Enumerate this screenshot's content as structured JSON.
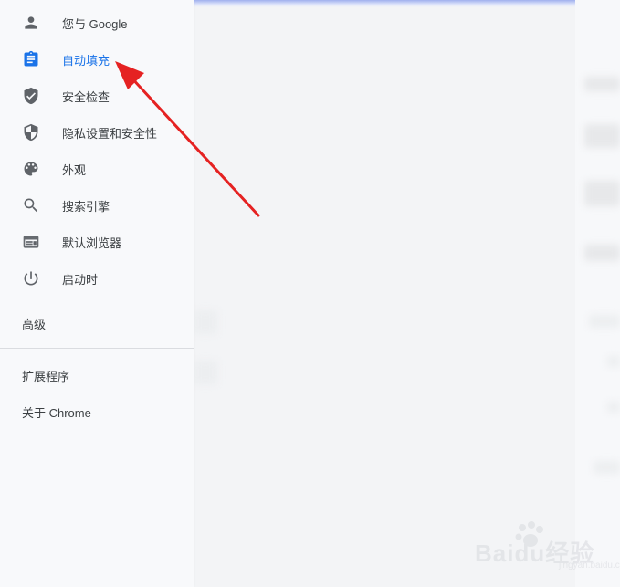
{
  "sidebar": {
    "items": [
      {
        "label": "您与 Google",
        "icon": "person-icon"
      },
      {
        "label": "自动填充",
        "icon": "clipboard-icon",
        "active": true
      },
      {
        "label": "安全检查",
        "icon": "shield-check-icon"
      },
      {
        "label": "隐私设置和安全性",
        "icon": "shield-half-icon"
      },
      {
        "label": "外观",
        "icon": "palette-icon"
      },
      {
        "label": "搜索引擎",
        "icon": "search-icon"
      },
      {
        "label": "默认浏览器",
        "icon": "browser-window-icon"
      },
      {
        "label": "启动时",
        "icon": "power-icon"
      }
    ],
    "advanced_label": "高级",
    "extensions_label": "扩展程序",
    "about_label": "关于 Chrome"
  },
  "watermark": {
    "text": "Baidu经验",
    "subtext": "jingyan.baidu.com"
  },
  "colors": {
    "active": "#1a73e8",
    "icon": "#5f6368",
    "text": "#3c4043",
    "arrow": "#e52222"
  }
}
